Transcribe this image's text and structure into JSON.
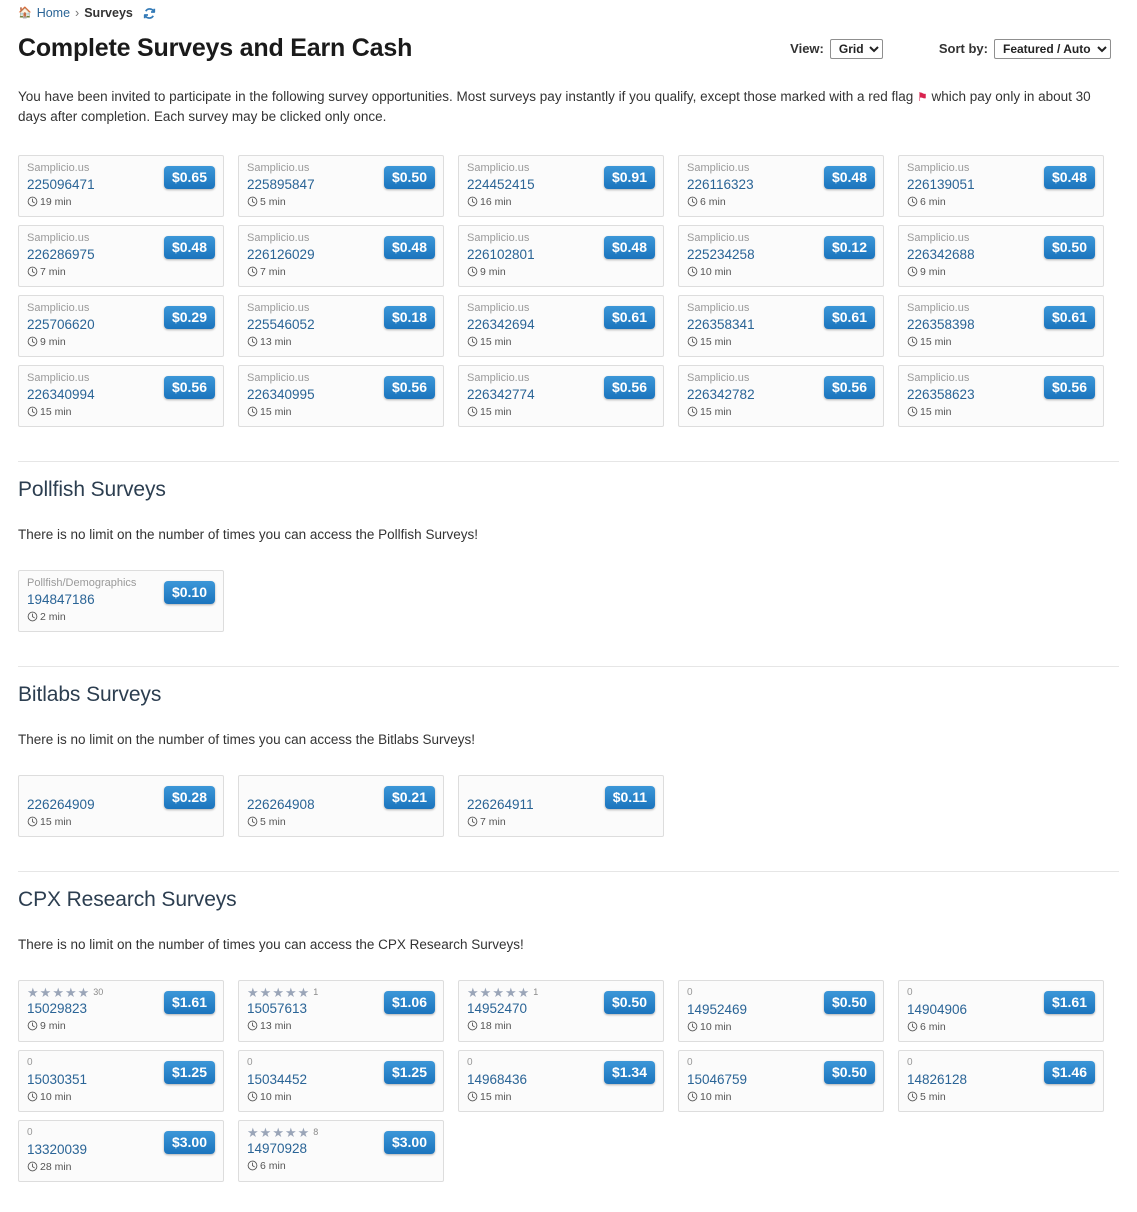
{
  "breadcrumb": {
    "home_label": "Home",
    "separator": "›",
    "current_label": "Surveys",
    "home_icon": "home-icon",
    "refresh_icon": "refresh-icon"
  },
  "header": {
    "title": "Complete Surveys and Earn Cash",
    "view_label": "View:",
    "view_value": "Grid",
    "view_options": [
      "Grid"
    ],
    "sort_label": "Sort by:",
    "sort_value": "Featured / Auto",
    "sort_options": [
      "Featured / Auto"
    ]
  },
  "intro": {
    "part1": "You have been invited to participate in the following survey opportunities. Most surveys pay instantly if you qualify, except those marked with a red flag ",
    "flag": "⚑",
    "part2": " which pay only in about 30 days after completion. Each survey may be clicked only once."
  },
  "colors": {
    "accent": "#2a6496",
    "badge_top": "#3c97d8",
    "badge_bottom": "#1b74bd",
    "flag_red": "#d9234f",
    "star": "#9aa5b8"
  },
  "featured_surveys": [
    {
      "provider": "Samplicio.us",
      "id": "225096471",
      "time": "19 min",
      "price": "$0.65"
    },
    {
      "provider": "Samplicio.us",
      "id": "225895847",
      "time": "5 min",
      "price": "$0.50"
    },
    {
      "provider": "Samplicio.us",
      "id": "224452415",
      "time": "16 min",
      "price": "$0.91"
    },
    {
      "provider": "Samplicio.us",
      "id": "226116323",
      "time": "6 min",
      "price": "$0.48"
    },
    {
      "provider": "Samplicio.us",
      "id": "226139051",
      "time": "6 min",
      "price": "$0.48"
    },
    {
      "provider": "Samplicio.us",
      "id": "226286975",
      "time": "7 min",
      "price": "$0.48"
    },
    {
      "provider": "Samplicio.us",
      "id": "226126029",
      "time": "7 min",
      "price": "$0.48"
    },
    {
      "provider": "Samplicio.us",
      "id": "226102801",
      "time": "9 min",
      "price": "$0.48"
    },
    {
      "provider": "Samplicio.us",
      "id": "225234258",
      "time": "10 min",
      "price": "$0.12"
    },
    {
      "provider": "Samplicio.us",
      "id": "226342688",
      "time": "9 min",
      "price": "$0.50"
    },
    {
      "provider": "Samplicio.us",
      "id": "225706620",
      "time": "9 min",
      "price": "$0.29"
    },
    {
      "provider": "Samplicio.us",
      "id": "225546052",
      "time": "13 min",
      "price": "$0.18"
    },
    {
      "provider": "Samplicio.us",
      "id": "226342694",
      "time": "15 min",
      "price": "$0.61"
    },
    {
      "provider": "Samplicio.us",
      "id": "226358341",
      "time": "15 min",
      "price": "$0.61"
    },
    {
      "provider": "Samplicio.us",
      "id": "226358398",
      "time": "15 min",
      "price": "$0.61"
    },
    {
      "provider": "Samplicio.us",
      "id": "226340994",
      "time": "15 min",
      "price": "$0.56"
    },
    {
      "provider": "Samplicio.us",
      "id": "226340995",
      "time": "15 min",
      "price": "$0.56"
    },
    {
      "provider": "Samplicio.us",
      "id": "226342774",
      "time": "15 min",
      "price": "$0.56"
    },
    {
      "provider": "Samplicio.us",
      "id": "226342782",
      "time": "15 min",
      "price": "$0.56"
    },
    {
      "provider": "Samplicio.us",
      "id": "226358623",
      "time": "15 min",
      "price": "$0.56"
    }
  ],
  "sections": [
    {
      "title": "Pollfish Surveys",
      "description": "There is no limit on the number of times you can access the Pollfish Surveys!",
      "card_type": "provider",
      "cards": [
        {
          "provider": "Pollfish/Demographics",
          "id": "194847186",
          "time": "2 min",
          "price": "$0.10"
        }
      ]
    },
    {
      "title": "Bitlabs Surveys",
      "description": "There is no limit on the number of times you can access the Bitlabs Surveys!",
      "card_type": "plain",
      "cards": [
        {
          "id": "226264909",
          "time": "15 min",
          "price": "$0.28"
        },
        {
          "id": "226264908",
          "time": "5 min",
          "price": "$0.21"
        },
        {
          "id": "226264911",
          "time": "7 min",
          "price": "$0.11"
        }
      ]
    },
    {
      "title": "CPX Research Surveys",
      "description": "There is no limit on the number of times you can access the CPX Research Surveys!",
      "card_type": "rating",
      "cards": [
        {
          "id": "15029823",
          "time": "9 min",
          "price": "$1.61",
          "stars": 5,
          "rating_count": "30"
        },
        {
          "id": "15057613",
          "time": "13 min",
          "price": "$1.06",
          "stars": 5,
          "rating_count": "1"
        },
        {
          "id": "14952470",
          "time": "18 min",
          "price": "$0.50",
          "stars": 5,
          "rating_count": "1"
        },
        {
          "id": "14952469",
          "time": "10 min",
          "price": "$0.50",
          "stars": 0,
          "rating_count": "0"
        },
        {
          "id": "14904906",
          "time": "6 min",
          "price": "$1.61",
          "stars": 0,
          "rating_count": "0"
        },
        {
          "id": "15030351",
          "time": "10 min",
          "price": "$1.25",
          "stars": 0,
          "rating_count": "0"
        },
        {
          "id": "15034452",
          "time": "10 min",
          "price": "$1.25",
          "stars": 0,
          "rating_count": "0"
        },
        {
          "id": "14968436",
          "time": "15 min",
          "price": "$1.34",
          "stars": 0,
          "rating_count": "0"
        },
        {
          "id": "15046759",
          "time": "10 min",
          "price": "$0.50",
          "stars": 0,
          "rating_count": "0"
        },
        {
          "id": "14826128",
          "time": "5 min",
          "price": "$1.46",
          "stars": 0,
          "rating_count": "0"
        },
        {
          "id": "13320039",
          "time": "28 min",
          "price": "$3.00",
          "stars": 0,
          "rating_count": "0"
        },
        {
          "id": "14970928",
          "time": "6 min",
          "price": "$3.00",
          "stars": 5,
          "rating_count": "8"
        }
      ]
    }
  ]
}
